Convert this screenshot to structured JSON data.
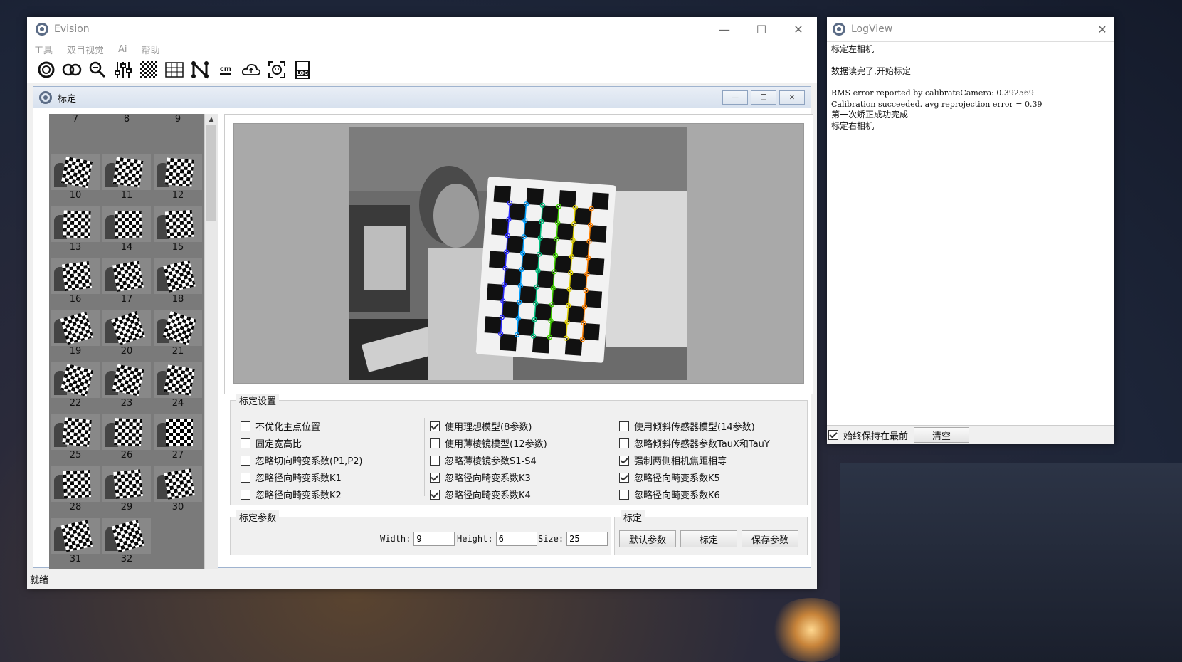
{
  "main_window": {
    "title": "Evision",
    "menu": [
      "工具",
      "双目视觉",
      "Ai",
      "帮助"
    ],
    "toolbar_icons": [
      "camera-ring-icon",
      "stereo-icon",
      "zoom-icon",
      "sliders-icon",
      "checkerboard-icon",
      "grid-icon",
      "network-icon",
      "cm-icon",
      "cloud-icon",
      "face-scan-icon",
      "log-icon"
    ],
    "toolbar_cm_text": "cm",
    "toolbar_log_text": "LOG",
    "status": "就绪"
  },
  "calib_window": {
    "title": "标定",
    "thumbnails": [
      "7",
      "8",
      "9",
      "10",
      "11",
      "12",
      "13",
      "14",
      "15",
      "16",
      "17",
      "18",
      "19",
      "20",
      "21",
      "22",
      "23",
      "24",
      "25",
      "26",
      "27",
      "28",
      "29",
      "30",
      "31",
      "32"
    ],
    "settings_group": "标定设置",
    "checkboxes": [
      {
        "label": "不优化主点位置",
        "checked": false
      },
      {
        "label": "固定宽高比",
        "checked": false
      },
      {
        "label": "忽略切向畸变系数(P1,P2)",
        "checked": false
      },
      {
        "label": "忽略径向畸变系数K1",
        "checked": false
      },
      {
        "label": "忽略径向畸变系数K2",
        "checked": false
      },
      {
        "label": "使用理想模型(8参数)",
        "checked": true
      },
      {
        "label": "使用薄棱镜模型(12参数)",
        "checked": false
      },
      {
        "label": "忽略薄棱镜参数S1-S4",
        "checked": false
      },
      {
        "label": "忽略径向畸变系数K3",
        "checked": true
      },
      {
        "label": "忽略径向畸变系数K4",
        "checked": true
      },
      {
        "label": "使用倾斜传感器模型(14参数)",
        "checked": false
      },
      {
        "label": "忽略倾斜传感器参数TauX和TauY",
        "checked": false
      },
      {
        "label": "强制两侧相机焦距相等",
        "checked": true
      },
      {
        "label": "忽略径向畸变系数K5",
        "checked": true
      },
      {
        "label": "忽略径向畸变系数K6",
        "checked": false
      }
    ],
    "params_group": "标定参数",
    "width_label": "Width:",
    "width_value": "9",
    "height_label": "Height:",
    "height_value": "6",
    "size_label": "Size:",
    "size_value": "25",
    "calib_group": "标定",
    "btn_default": "默认参数",
    "btn_calibrate": "标定",
    "btn_save": "保存参数"
  },
  "log_window": {
    "title": "LogView",
    "lines": [
      "标定左相机",
      "",
      "数据读完了,开始标定",
      "",
      "RMS error reported by calibrateCamera: 0.392569",
      "Calibration succeeded. avg reprojection error = 0.39",
      "第一次矫正成功完成",
      "标定右相机"
    ],
    "always_on_top": "始终保持在最前",
    "always_on_top_checked": true,
    "clear": "清空"
  }
}
